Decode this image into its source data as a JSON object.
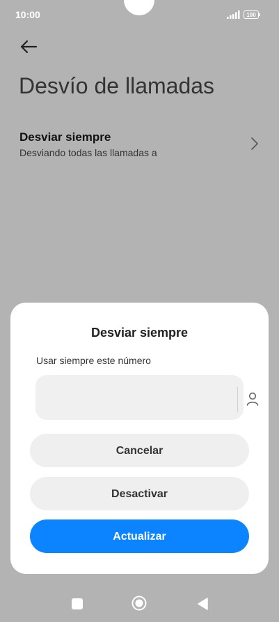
{
  "status_bar": {
    "time": "10:00",
    "battery": "100"
  },
  "header": {
    "title": "Desvío de llamadas"
  },
  "setting_row": {
    "title": "Desviar siempre",
    "subtitle": "Desviando todas las llamadas a"
  },
  "dialog": {
    "title": "Desviar siempre",
    "field_label": "Usar siempre este número",
    "number_value": "",
    "number_placeholder": "",
    "cancel_label": "Cancelar",
    "deactivate_label": "Desactivar",
    "update_label": "Actualizar"
  },
  "colors": {
    "accent": "#0d84ff",
    "scrim": "#b3b3b3",
    "surface": "#ffffff",
    "field": "#f0f0f0"
  },
  "icons": [
    "back-arrow-icon",
    "chevron-right-icon",
    "contact-icon",
    "signal-icon",
    "battery-icon",
    "recent-apps-icon",
    "home-icon",
    "back-triangle-icon"
  ]
}
